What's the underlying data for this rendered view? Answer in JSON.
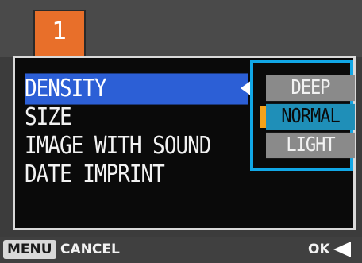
{
  "tab": {
    "number": "1"
  },
  "menu": {
    "items": [
      {
        "label": "DENSITY",
        "selected": true
      },
      {
        "label": "SIZE",
        "selected": false
      },
      {
        "label": "IMAGE WITH SOUND",
        "selected": false
      },
      {
        "label": "DATE IMPRINT",
        "selected": false
      }
    ]
  },
  "options": {
    "items": [
      {
        "label": "DEEP",
        "current": false
      },
      {
        "label": "NORMAL",
        "current": true
      },
      {
        "label": "LIGHT",
        "current": false
      }
    ]
  },
  "footer": {
    "menu_key": "MENU",
    "cancel_label": "CANCEL",
    "ok_label": "OK"
  },
  "colors": {
    "tab": "#e86f2a",
    "selection": "#2c5fd6",
    "options_frame": "#11a7e6",
    "active_option": "#1f8fb8",
    "marker": "#f5a21a"
  }
}
